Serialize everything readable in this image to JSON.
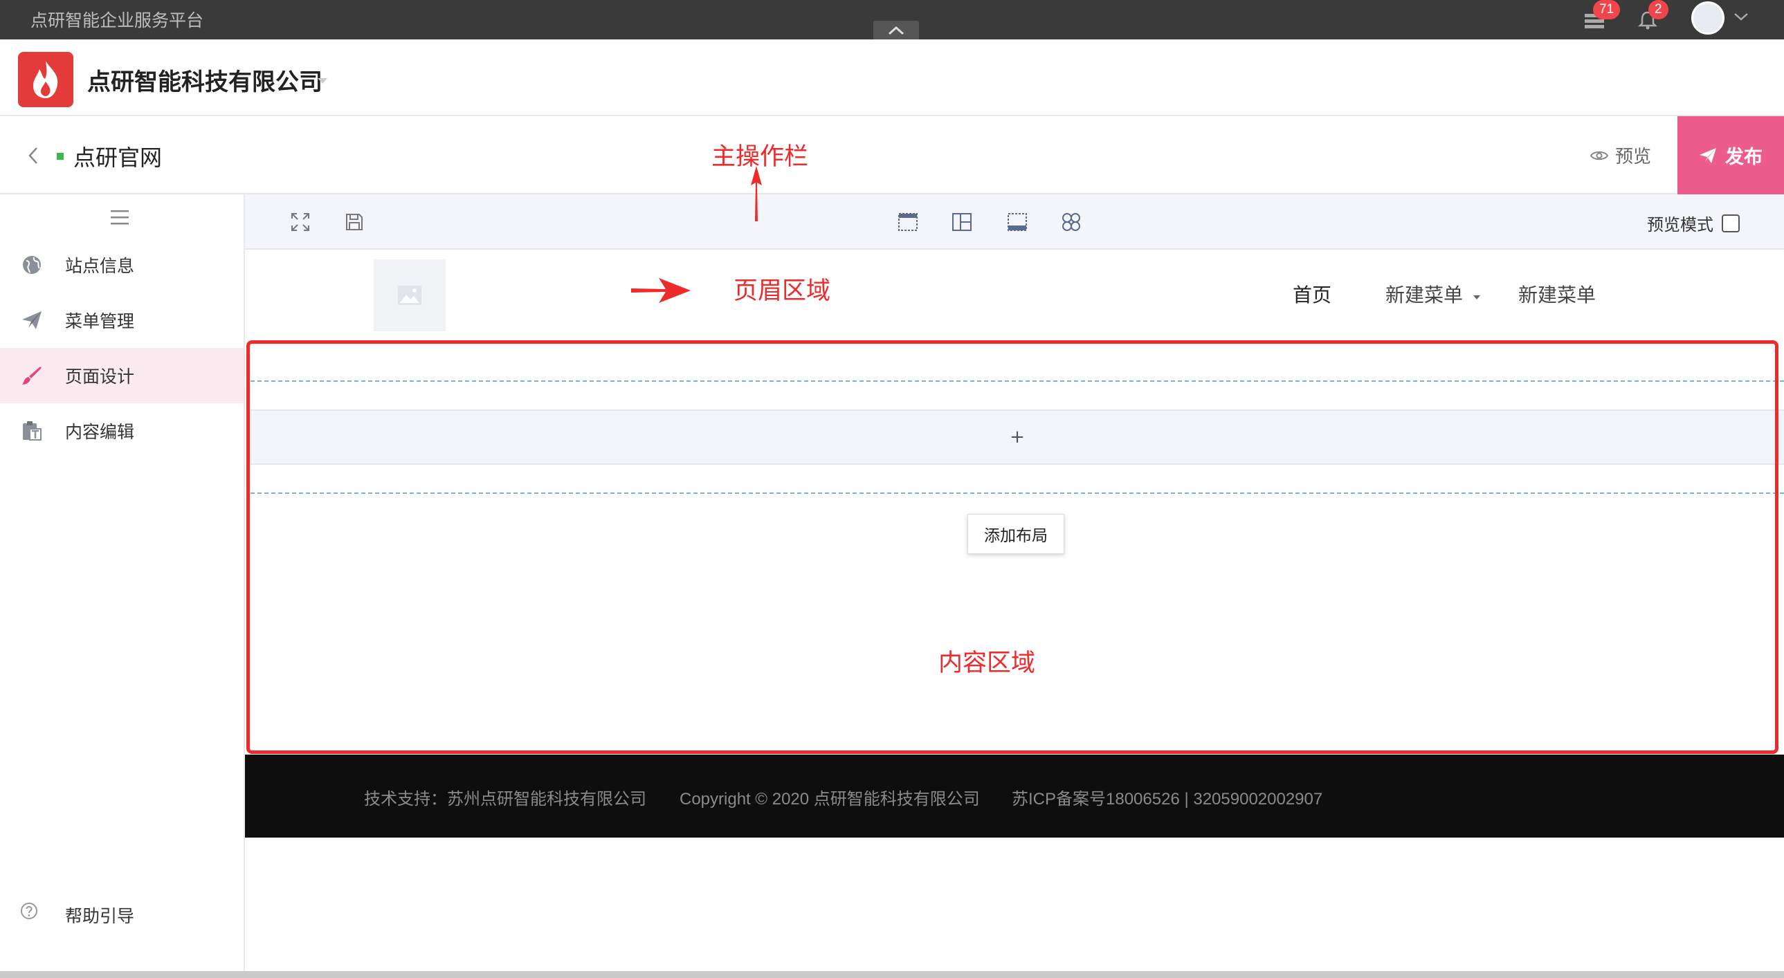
{
  "system_bar": {
    "title": "点研智能企业服务平台",
    "notifications": {
      "apps_count": "71",
      "bell_count": "2"
    }
  },
  "company": {
    "name": "点研智能科技有限公司"
  },
  "site": {
    "name": "点研官网",
    "preview_label": "预览",
    "publish_label": "发布"
  },
  "sidebar": {
    "items": [
      {
        "label": "站点信息",
        "icon": "globe-icon"
      },
      {
        "label": "菜单管理",
        "icon": "paper-plane-icon"
      },
      {
        "label": "页面设计",
        "icon": "brush-icon",
        "active": true
      },
      {
        "label": "内容编辑",
        "icon": "text-clipboard-icon"
      }
    ],
    "help_label": "帮助引导"
  },
  "toolbar": {
    "preview_mode_label": "预览模式",
    "preview_mode_checked": false
  },
  "canvas_header": {
    "menu": [
      {
        "label": "首页"
      },
      {
        "label": "新建菜单",
        "has_dropdown": true
      },
      {
        "label": "新建菜单"
      }
    ]
  },
  "content": {
    "add_row_symbol": "+",
    "add_layout_label": "添加布局"
  },
  "annotations": {
    "main_toolbar": "主操作栏",
    "header_area": "页眉区域",
    "content_area": "内容区域"
  },
  "footer": {
    "support": "技术支持：苏州点研智能科技有限公司",
    "copyright": "Copyright © 2020 点研智能科技有限公司",
    "icp": "苏ICP备案号18006526 | 32059002002907"
  },
  "colors": {
    "accent_publish": "#ec5c8c",
    "annotation_red": "#ee2a2a",
    "active_nav_bg": "#fbeaf0",
    "logo_red": "#e33a3a"
  }
}
